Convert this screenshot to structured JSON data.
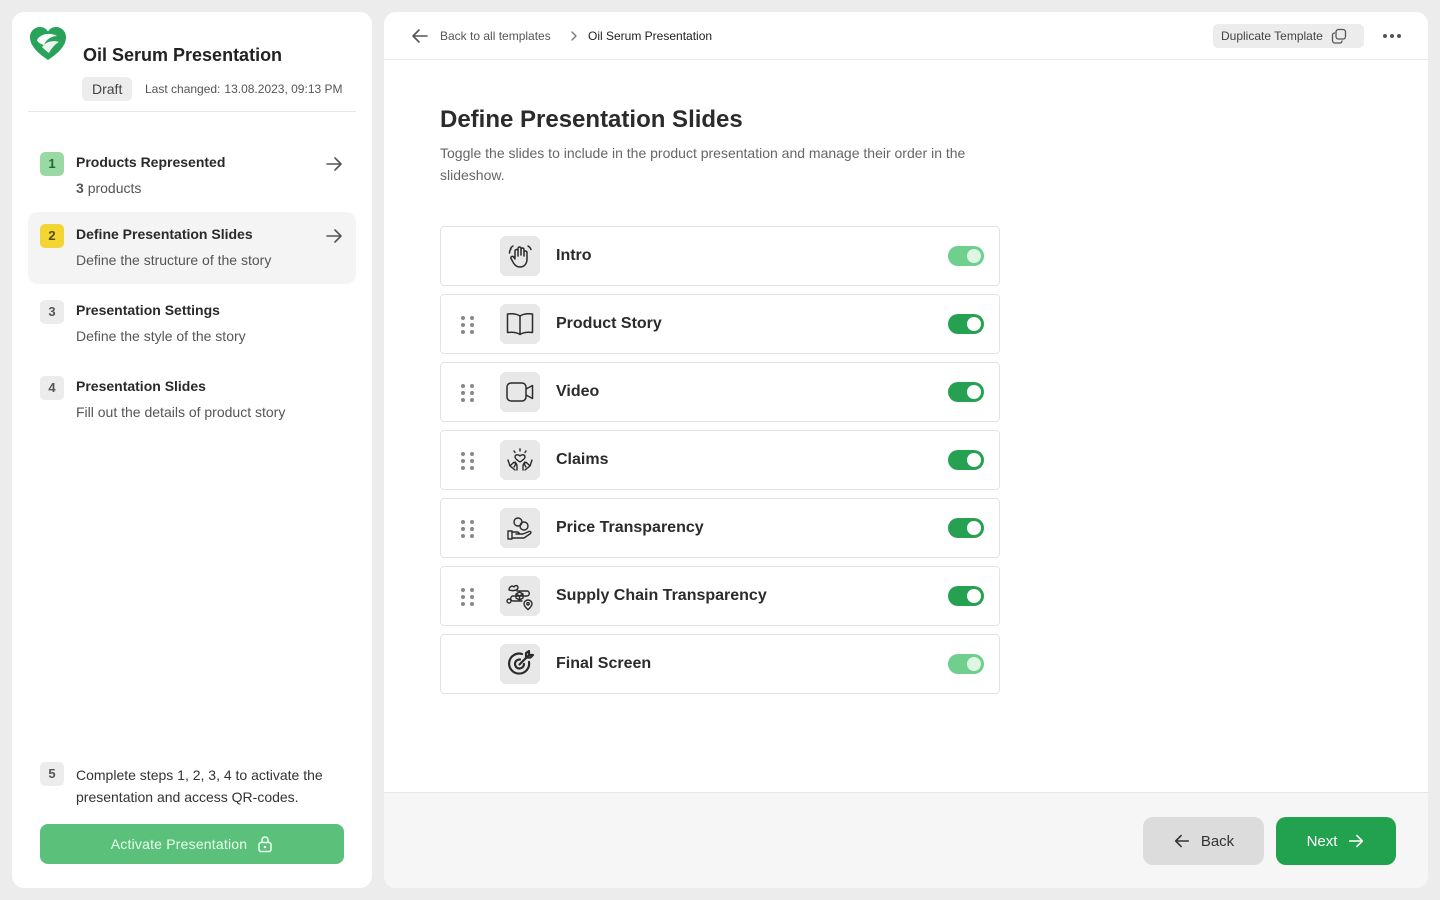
{
  "app": {
    "title": "Oil Serum Presentation",
    "status": "Draft",
    "last_changed_label": "Last changed:",
    "last_changed_value": "13.08.2023, 09:13 PM",
    "brand_color": "#22a14f"
  },
  "steps": [
    {
      "num": "1",
      "title": "Products Represented",
      "sub_count": "3",
      "sub": "products",
      "state": "done"
    },
    {
      "num": "2",
      "title": "Define Presentation Slides",
      "sub": "Define the structure of the story",
      "state": "current"
    },
    {
      "num": "3",
      "title": "Presentation Settings",
      "sub": "Define the style of the story",
      "state": "pending"
    },
    {
      "num": "4",
      "title": "Presentation Slides",
      "sub": "Fill out the details of product story",
      "state": "pending"
    }
  ],
  "step5": {
    "num": "5",
    "text": "Complete steps 1, 2, 3, 4 to activate the presentation and access QR-codes."
  },
  "activate_button": "Activate Presentation",
  "breadcrumb": {
    "back": "Back to all templates",
    "current": "Oil Serum Presentation"
  },
  "duplicate_button": "Duplicate Template",
  "page": {
    "title": "Define Presentation Slides",
    "description": "Toggle the slides to include in the product presentation and manage their order in the slideshow."
  },
  "slides": [
    {
      "label": "Intro",
      "icon": "hand-wave-icon",
      "enabled": true,
      "draggable": false
    },
    {
      "label": "Product Story",
      "icon": "open-book-icon",
      "enabled": true,
      "draggable": true
    },
    {
      "label": "Video",
      "icon": "video-camera-icon",
      "enabled": true,
      "draggable": true
    },
    {
      "label": "Claims",
      "icon": "hands-heart-icon",
      "enabled": true,
      "draggable": true
    },
    {
      "label": "Price Transparency",
      "icon": "hand-coins-icon",
      "enabled": true,
      "draggable": true
    },
    {
      "label": "Supply Chain Transparency",
      "icon": "supply-route-icon",
      "enabled": true,
      "draggable": true
    },
    {
      "label": "Final Screen",
      "icon": "target-arrow-icon",
      "enabled": true,
      "draggable": false
    }
  ],
  "footer": {
    "back": "Back",
    "next": "Next"
  }
}
